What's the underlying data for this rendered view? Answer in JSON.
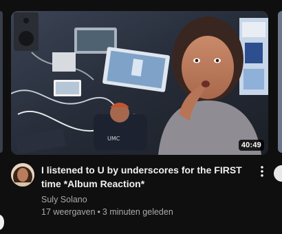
{
  "video": {
    "duration": "40:49",
    "title": "I listened to U by underscores for the FIRST time *Album Reaction*",
    "channel": "Suly Solano",
    "views": "17 weergaven",
    "separator": "•",
    "age": "3 minuten geleden",
    "more_icon": "more-vert-icon"
  },
  "colors": {
    "background": "#0f0f0f",
    "title": "#f1f1f1",
    "secondary_text": "#aaaaaa",
    "badge_bg": "#000000"
  }
}
